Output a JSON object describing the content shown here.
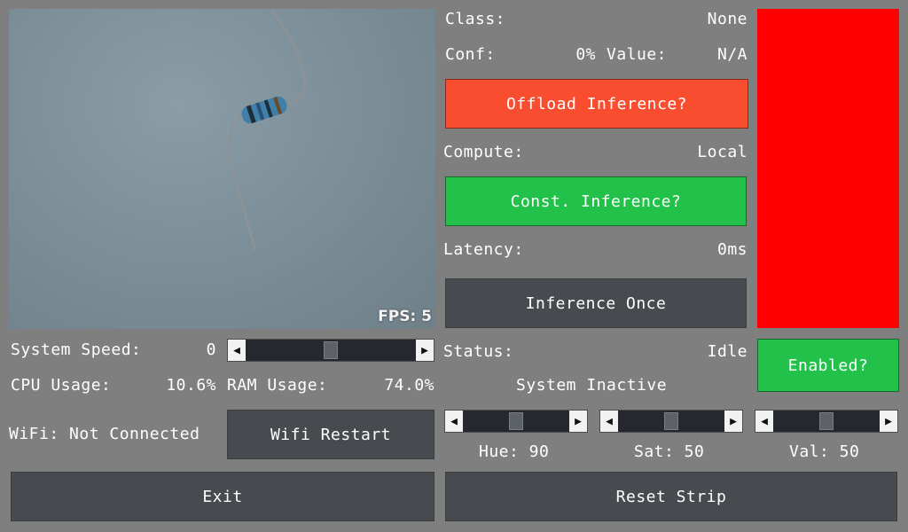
{
  "camera": {
    "fps_text": "FPS: 5"
  },
  "classification": {
    "class_label": "Class:",
    "class_value": "None",
    "conf_label": "Conf:",
    "conf_value": "0%",
    "value_label": "Value:",
    "value_value": "N/A"
  },
  "buttons": {
    "offload": "Offload Inference?",
    "const": "Const. Inference?",
    "once": "Inference Once",
    "enabled": "Enabled?",
    "wifi_restart": "Wifi Restart",
    "exit": "Exit",
    "reset_strip": "Reset Strip"
  },
  "compute": {
    "label": "Compute:",
    "value": "Local"
  },
  "latency": {
    "label": "Latency:",
    "value": "0ms"
  },
  "status": {
    "label": "Status:",
    "value": "Idle",
    "message": "System Inactive"
  },
  "system": {
    "speed_label": "System Speed:",
    "speed_value": "0",
    "speed_slider_level": 0.5,
    "cpu_label": "CPU Usage:",
    "cpu_value": "10.6%",
    "ram_label": "RAM Usage:",
    "ram_value": "74.0%",
    "wifi_text": "WiFi: Not Connected"
  },
  "color_controls": {
    "hue_text": "Hue: 90",
    "hue_level": 0.5,
    "sat_text": "Sat: 50",
    "sat_level": 0.5,
    "val_text": "Val: 50",
    "val_level": 0.5
  },
  "colors": {
    "background": "#7f7f7f",
    "led_preview": "#ff0000",
    "offload_button": "#f84e2f",
    "toggle_on": "#22c24a",
    "dark_button": "#474b4f"
  }
}
